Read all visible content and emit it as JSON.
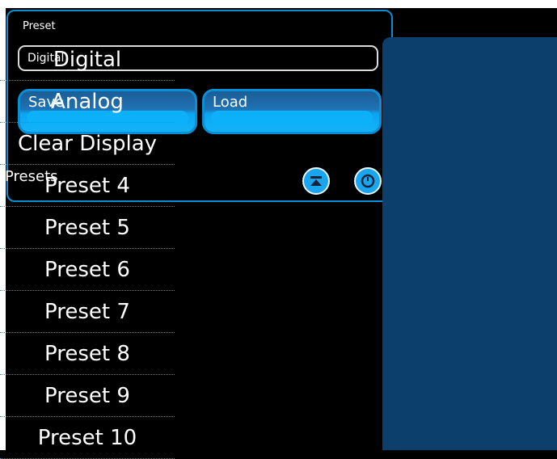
{
  "panel": {
    "preset_label": "Preset",
    "preset_value": "Digital",
    "save_label": "Save",
    "load_label": "Load",
    "presets_label": "Presets",
    "buttons": [
      {
        "icon": "eject-icon"
      },
      {
        "icon": "clock-icon"
      }
    ]
  },
  "dropdown": {
    "options": [
      {
        "label": "Digital"
      },
      {
        "label": "Analog"
      },
      {
        "label": "Clear Display"
      },
      {
        "label": "Preset 4"
      },
      {
        "label": "Preset 5"
      },
      {
        "label": "Preset 6"
      },
      {
        "label": "Preset 7"
      },
      {
        "label": "Preset 8"
      },
      {
        "label": "Preset 9"
      },
      {
        "label": "Preset 10"
      }
    ]
  },
  "colors": {
    "background": "#000000",
    "accent": "#0a8fd6",
    "dropdown_bg": "#0c3f6b",
    "button_light": "#14b3f8"
  }
}
